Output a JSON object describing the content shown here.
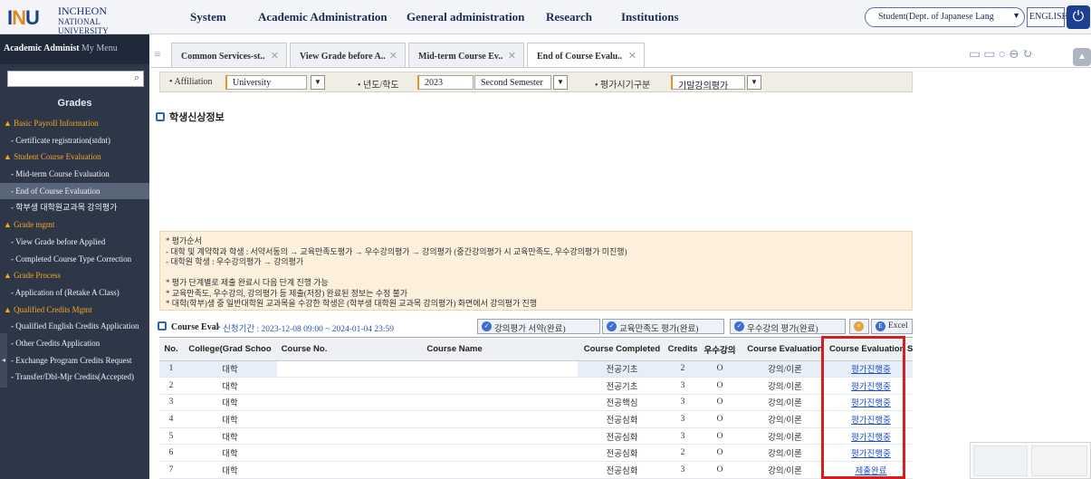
{
  "header": {
    "logo_mark": "INU",
    "logo_name": "INCHEON",
    "logo_sub": "NATIONAL UNIVERSITY",
    "nav": [
      "System",
      "Academic Administration",
      "General administration",
      "Research",
      "Institutions"
    ],
    "role": "Student(Dept. of Japanese Lang",
    "language": "ENGLISH"
  },
  "sidebar": {
    "tab_active": "Academic Administ",
    "tab_inactive": "My Menu",
    "title": "Grades",
    "items": [
      {
        "label": "Basic Payroll Information",
        "type": "group"
      },
      {
        "label": "- Certificate registration(stdnt)",
        "type": "leaf"
      },
      {
        "label": "Student Course Evaluation",
        "type": "group"
      },
      {
        "label": "- Mid-term Course Evaluation",
        "type": "leaf"
      },
      {
        "label": "- End of Course Evaluation",
        "type": "current"
      },
      {
        "label": "- 학부생 대학원교과목 강의평가",
        "type": "leaf"
      },
      {
        "label": "Grade mgmt",
        "type": "group"
      },
      {
        "label": "- View Grade before Applied",
        "type": "leaf"
      },
      {
        "label": "- Completed Course Type Correction",
        "type": "leaf"
      },
      {
        "label": "Grade Process",
        "type": "group"
      },
      {
        "label": "- Application of (Retake A Class)",
        "type": "leaf"
      },
      {
        "label": "Qualified Credits Mgmt",
        "type": "group"
      },
      {
        "label": "- Qualified English Credits Application",
        "type": "leaf"
      },
      {
        "label": "- Other Credits Application",
        "type": "leaf"
      },
      {
        "label": "- Exchange Program Credits Request",
        "type": "leaf"
      },
      {
        "label": "- Transfer/Dbl-Mjr Credits(Accepted)",
        "type": "leaf"
      }
    ]
  },
  "tabs": [
    {
      "label": "Common Services-st..",
      "active": false
    },
    {
      "label": "View Grade before A..",
      "active": false
    },
    {
      "label": "Mid-term Course Ev..",
      "active": false
    },
    {
      "label": "End of Course Evalu..",
      "active": true
    }
  ],
  "filter": {
    "affiliation_label": "Affiliation",
    "affiliation_value": "University",
    "year_label": "년도/학도",
    "year_value": "2023",
    "semester_value": "Second Semester",
    "eval_type_label": "평가시기구분",
    "eval_type_value": "기말강의평가"
  },
  "section_title": "학생신상정보",
  "notice_lines": [
    "* 평가순서",
    "- 대학 및 계약학과 학생 : 서약서동의 → 교육만족도평가 → 우수강의평가 → 강의평가 (중간강의평가 시 교육만족도, 우수강의평가 미진행)",
    "- 대학원 학생 : 우수강의평가 → 강의평가",
    "",
    "* 평가 단계별로 제출 완료시 다음 단계 진행 가능",
    "* 교육만족도, 우수강의, 강의평가 등 제출(저장) 완료된 정보는 수정 불가",
    "* 대학(학부)생 중 일반대학원 교과목을 수강한 학생은 (학부생 대학원 교과목 강의평가) 화면에서 강의평가 진행"
  ],
  "grid": {
    "title": "Course Eval",
    "period": "* 신청기간 : 2023-12-08 09:00 ~ 2024-01-04 23:59",
    "buttons": [
      "강의평가 서약(완료)",
      "교육만족도 평가(완료)",
      "우수강의 평가(완료)",
      "",
      "Excel"
    ],
    "columns": [
      "No.",
      "College(Grad Schoo",
      "Course No.",
      "Course Name",
      "Course Completed",
      "Credits",
      "우수강의",
      "Course Evaluation",
      "Course Evaluation S"
    ],
    "rows": [
      {
        "no": "1",
        "college": "대학",
        "course_no": "",
        "course_name": "",
        "completed": "전공기초",
        "credits": "2",
        "excellent": "O",
        "eval_type": "강의/이론",
        "status": "평가진행중"
      },
      {
        "no": "2",
        "college": "대학",
        "course_no": "",
        "course_name": "",
        "completed": "전공기초",
        "credits": "3",
        "excellent": "O",
        "eval_type": "강의/이론",
        "status": "평가진행중"
      },
      {
        "no": "3",
        "college": "대학",
        "course_no": "",
        "course_name": "",
        "completed": "전공핵심",
        "credits": "3",
        "excellent": "O",
        "eval_type": "강의/이론",
        "status": "평가진행중"
      },
      {
        "no": "4",
        "college": "대학",
        "course_no": "",
        "course_name": "",
        "completed": "전공심화",
        "credits": "3",
        "excellent": "O",
        "eval_type": "강의/이론",
        "status": "평가진행중"
      },
      {
        "no": "5",
        "college": "대학",
        "course_no": "",
        "course_name": "",
        "completed": "전공심화",
        "credits": "3",
        "excellent": "O",
        "eval_type": "강의/이론",
        "status": "평가진행중"
      },
      {
        "no": "6",
        "college": "대학",
        "course_no": "",
        "course_name": "",
        "completed": "전공심화",
        "credits": "2",
        "excellent": "O",
        "eval_type": "강의/이론",
        "status": "평가진행중"
      },
      {
        "no": "7",
        "college": "대학",
        "course_no": "",
        "course_name": "",
        "completed": "전공심화",
        "credits": "3",
        "excellent": "O",
        "eval_type": "강의/이론",
        "status": "제출완료"
      }
    ]
  },
  "colors": {
    "sidebar_bg": "#2d3748",
    "group_accent": "#f6a623",
    "brand_blue": "#1d3f8f",
    "link": "#1f4fc4",
    "highlight_border": "#d21f1f",
    "notice_bg": "#fcefdc"
  }
}
